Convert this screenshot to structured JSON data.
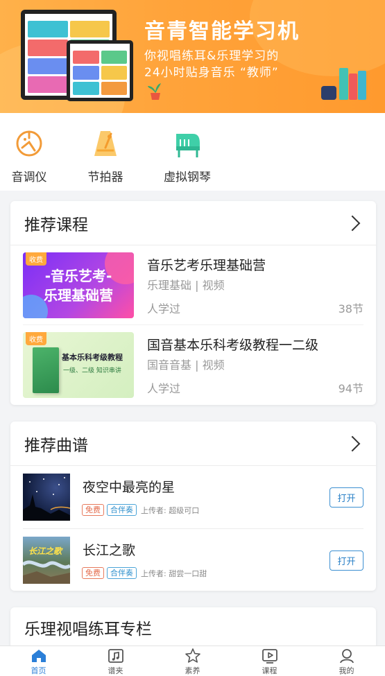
{
  "banner": {
    "title": "音青智能学习机",
    "line1": "你视唱练耳&乐理学习的",
    "line2": "24小时贴身音乐 “教师”"
  },
  "tools": [
    {
      "label": "音调仪",
      "icon": "tuner-icon"
    },
    {
      "label": "节拍器",
      "icon": "metronome-icon"
    },
    {
      "label": "虚拟钢琴",
      "icon": "piano-icon"
    }
  ],
  "recommended_courses": {
    "title": "推荐课程",
    "items": [
      {
        "title": "音乐艺考乐理基础营",
        "subtitle": "乐理基础 | 视频",
        "learned": "人学过",
        "lessons": "38节",
        "paid_tag": "收费",
        "thumb_text": [
          "-音乐艺考-",
          "乐理基础营"
        ]
      },
      {
        "title": "国音基本乐科考级教程一二级",
        "subtitle": "国音音基 | 视频",
        "learned": "人学过",
        "lessons": "94节",
        "paid_tag": "收费",
        "thumb_text": [
          "基本乐科考级教程",
          "一级、二级 知识串讲"
        ]
      }
    ]
  },
  "recommended_scores": {
    "title": "推荐曲谱",
    "items": [
      {
        "title": "夜空中最亮的星",
        "free": "免费",
        "type": "合伴奏",
        "uploader": "上传者: 超级可口",
        "action": "打开"
      },
      {
        "title": "长江之歌",
        "free": "免费",
        "type": "合伴奏",
        "uploader": "上传者: 甜尝一口甜",
        "action": "打开",
        "thumb_text": "长江之歌"
      }
    ]
  },
  "column": {
    "title": "乐理视唱练耳专栏"
  },
  "tabbar": [
    {
      "label": "首页",
      "icon": "home-icon",
      "active": true
    },
    {
      "label": "谱夹",
      "icon": "music-folder-icon",
      "active": false
    },
    {
      "label": "素养",
      "icon": "star-icon",
      "active": false
    },
    {
      "label": "课程",
      "icon": "video-course-icon",
      "active": false
    },
    {
      "label": "我的",
      "icon": "user-icon",
      "active": false
    }
  ],
  "colors": {
    "accent": "#2b7fd8",
    "banner": "#ffa33a",
    "free_badge": "#e36a4a",
    "duet_badge": "#2d8fcc"
  }
}
